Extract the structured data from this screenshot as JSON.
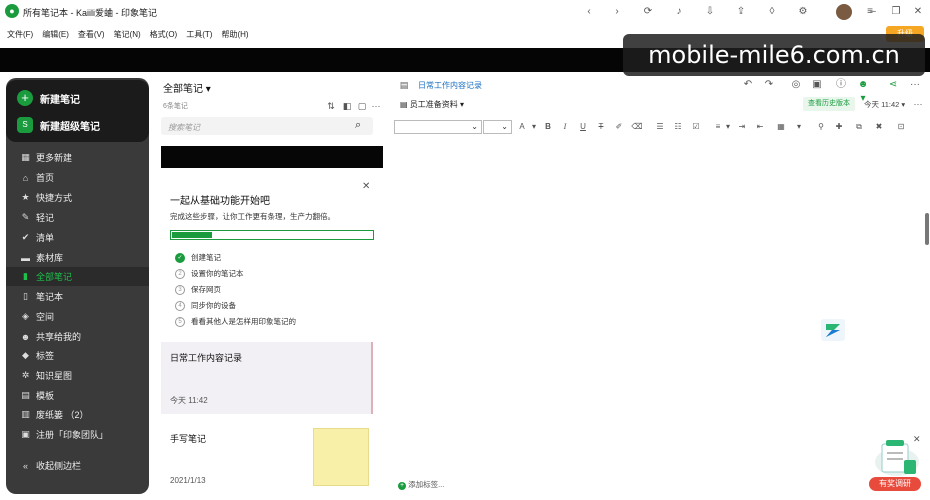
{
  "window": {
    "title": "所有笔记本 - Kaiili爱蛐 - 印象笔记",
    "upgrade_label": "升级"
  },
  "menu": [
    "文件(F)",
    "编辑(E)",
    "查看(V)",
    "笔记(N)",
    "格式(O)",
    "工具(T)",
    "帮助(H)"
  ],
  "watermark": "mobile-mile6.com.cn",
  "sidebar": {
    "new_note": "新建笔记",
    "new_super_note": "新建超级笔记",
    "items": [
      {
        "label": "更多新建",
        "icon": "grid-icon"
      },
      {
        "label": "首页",
        "icon": "home-icon"
      },
      {
        "label": "快捷方式",
        "icon": "star-icon"
      },
      {
        "label": "轻记",
        "icon": "pen-icon"
      },
      {
        "label": "清单",
        "icon": "check-circle-icon"
      },
      {
        "label": "素材库",
        "icon": "folder-icon"
      },
      {
        "label": "全部笔记",
        "icon": "note-icon"
      },
      {
        "label": "笔记本",
        "icon": "notebook-icon"
      },
      {
        "label": "空间",
        "icon": "cube-icon"
      },
      {
        "label": "共享给我的",
        "icon": "people-icon"
      },
      {
        "label": "标签",
        "icon": "tag-icon"
      },
      {
        "label": "知识星图",
        "icon": "graph-icon"
      },
      {
        "label": "模板",
        "icon": "template-icon"
      },
      {
        "label": "废纸篓 （2）",
        "icon": "trash-icon"
      },
      {
        "label": "注册「印象团队」",
        "icon": "team-icon"
      }
    ],
    "collapse": "收起侧边栏"
  },
  "note_list": {
    "title": "全部笔记",
    "count": "6条笔记",
    "search_placeholder": "搜索笔记"
  },
  "getting_started": {
    "title": "一起从基础功能开始吧",
    "subtitle": "完成这些步骤，让你工作更有条理，生产力翻倍。",
    "progress": 0.2,
    "steps": [
      {
        "label": "创建笔记",
        "done": true
      },
      {
        "label": "设置你的笔记本",
        "done": false
      },
      {
        "label": "保存网页",
        "done": false
      },
      {
        "label": "同步你的设备",
        "done": false
      },
      {
        "label": "看看其他人是怎样用印象笔记的",
        "done": false
      }
    ]
  },
  "notes": [
    {
      "title": "日常工作内容记录",
      "time": "今天 11:42"
    },
    {
      "title": "手写笔记",
      "time": "2021/1/13"
    }
  ],
  "editor": {
    "title": "日常工作内容记录",
    "notebook": "员工准备资料",
    "history_button": "查看历史版本",
    "today": "今天 11:42",
    "add_tag": "添加标签..."
  },
  "survey": {
    "label": "有奖调研"
  },
  "colors": {
    "brand_green": "#1a9c3e",
    "sidebar_bg": "#3a3a3a",
    "upgrade_orange": "#f5a623"
  }
}
